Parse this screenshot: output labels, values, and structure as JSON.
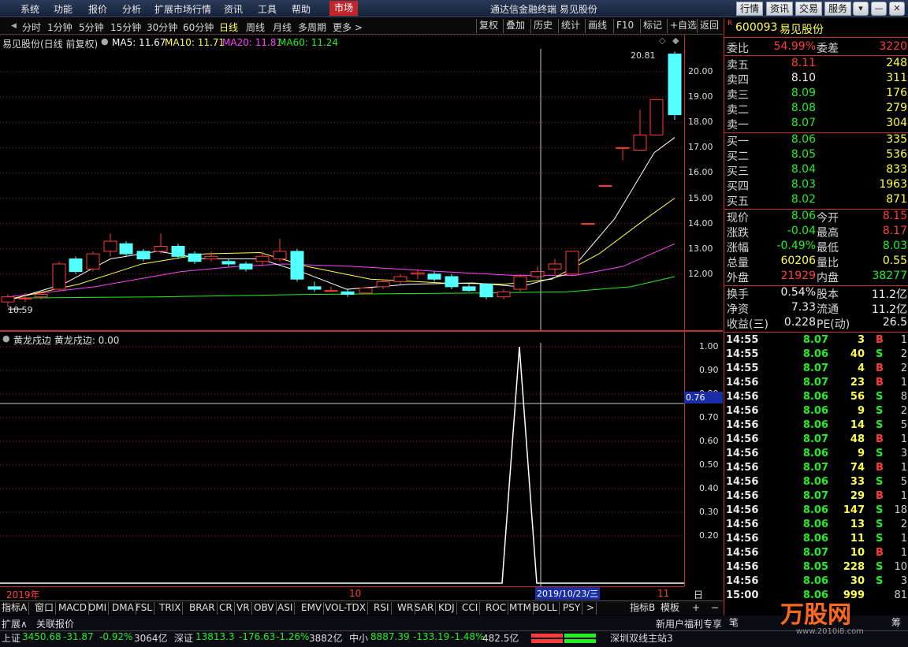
{
  "menu": {
    "items": [
      "系统",
      "功能",
      "报价",
      "分析",
      "扩展市场行情",
      "资讯",
      "工具",
      "帮助"
    ],
    "active": "市场",
    "app_title": "通达信金融终端 易见股份",
    "right_buttons": [
      "行情",
      "资讯",
      "交易",
      "服务"
    ]
  },
  "toolbar": {
    "periods": [
      "分时",
      "1分钟",
      "5分钟",
      "15分钟",
      "30分钟",
      "60分钟",
      "日线",
      "周线",
      "月线",
      "多周期",
      "更多 >"
    ],
    "active_period": "日线",
    "actions": [
      "复权",
      "叠加",
      "历史",
      "统计",
      "画线",
      "F10",
      "标记",
      "+自选",
      "返回"
    ]
  },
  "kline": {
    "header_name": "易见股份(日线 前复权)",
    "ma5": "MA5: 11.67",
    "ma10": "MA10: 11.71",
    "ma20": "MA20: 11.81",
    "ma60": "MA60: 11.24",
    "high_label": "20.81",
    "low_label": "10.59",
    "ylabels": [
      "20.00",
      "19.00",
      "18.00",
      "17.00",
      "16.00",
      "15.00",
      "14.00",
      "13.00",
      "12.00"
    ]
  },
  "indicator": {
    "header": "黄龙戍边  黄龙戍边: 0.00",
    "ylabels": [
      "1.00",
      "0.90",
      "0.80",
      "0.70",
      "0.60",
      "0.50",
      "0.40",
      "0.30",
      "0.20"
    ],
    "cursor_value": "0.76"
  },
  "dates": {
    "year": "2019年",
    "mid": "10",
    "cursor": "2019/10/23/三",
    "end": "11",
    "period": "日线"
  },
  "index_tabs": [
    "指标A",
    "窗口",
    "MACD",
    "DMI",
    "DMA",
    "FSL",
    "TRIX",
    "BRAR",
    "CR",
    "VR",
    "OBV",
    "ASI",
    "EMV",
    "VOL-TDX",
    "RSI",
    "WR",
    "SAR",
    "KDJ",
    "CCI",
    "ROC",
    "MTM",
    "BOLL",
    "PSY",
    ">"
  ],
  "index_right": [
    "指标B",
    "模板",
    "+",
    "−"
  ],
  "ext": {
    "left": "扩展∧",
    "mid": "关联报价",
    "right": "新用户福利专享"
  },
  "quote": {
    "code": "600093",
    "name": "易见股份",
    "weibi_label": "委比",
    "weibi": "54.99%",
    "weicha_label": "委差",
    "weicha": "3220",
    "sells": [
      {
        "label": "卖五",
        "price": "8.11",
        "vol": "248"
      },
      {
        "label": "卖四",
        "price": "8.10",
        "vol": "311"
      },
      {
        "label": "卖三",
        "price": "8.09",
        "vol": "176"
      },
      {
        "label": "卖二",
        "price": "8.08",
        "vol": "279"
      },
      {
        "label": "卖一",
        "price": "8.07",
        "vol": "304"
      }
    ],
    "buys": [
      {
        "label": "买一",
        "price": "8.06",
        "vol": "335"
      },
      {
        "label": "买二",
        "price": "8.05",
        "vol": "536"
      },
      {
        "label": "买三",
        "price": "8.04",
        "vol": "833"
      },
      {
        "label": "买四",
        "price": "8.03",
        "vol": "1963"
      },
      {
        "label": "买五",
        "price": "8.02",
        "vol": "871"
      }
    ],
    "stats": [
      {
        "l1": "现价",
        "v1": "8.06",
        "c1": "green",
        "l2": "今开",
        "v2": "8.15",
        "c2": "red"
      },
      {
        "l1": "涨跌",
        "v1": "-0.04",
        "c1": "green",
        "l2": "最高",
        "v2": "8.17",
        "c2": "red"
      },
      {
        "l1": "涨幅",
        "v1": "-0.49%",
        "c1": "green",
        "l2": "最低",
        "v2": "8.03",
        "c2": "green"
      },
      {
        "l1": "总量",
        "v1": "60206",
        "c1": "yellow",
        "l2": "量比",
        "v2": "0.55",
        "c2": "yellow"
      },
      {
        "l1": "外盘",
        "v1": "21929",
        "c1": "red",
        "l2": "内盘",
        "v2": "38277",
        "c2": "green"
      }
    ],
    "fund": [
      {
        "l1": "换手",
        "v1": "0.54%",
        "l2": "股本",
        "v2": "11.2亿"
      },
      {
        "l1": "净资",
        "v1": "7.33",
        "l2": "流通",
        "v2": "11.2亿"
      },
      {
        "l1": "收益(三)",
        "v1": "0.228",
        "l2": "PE(动)",
        "v2": "26.5"
      }
    ]
  },
  "ticks": [
    {
      "t": "14:55",
      "p": "8.07",
      "v": "3",
      "d": "B",
      "n": "1"
    },
    {
      "t": "14:55",
      "p": "8.06",
      "v": "40",
      "d": "S",
      "n": "2"
    },
    {
      "t": "14:55",
      "p": "8.07",
      "v": "4",
      "d": "B",
      "n": "2"
    },
    {
      "t": "14:56",
      "p": "8.07",
      "v": "23",
      "d": "B",
      "n": "1"
    },
    {
      "t": "14:56",
      "p": "8.06",
      "v": "56",
      "d": "S",
      "n": "8"
    },
    {
      "t": "14:56",
      "p": "8.06",
      "v": "9",
      "d": "S",
      "n": "2"
    },
    {
      "t": "14:56",
      "p": "8.06",
      "v": "14",
      "d": "S",
      "n": "5"
    },
    {
      "t": "14:56",
      "p": "8.07",
      "v": "48",
      "d": "B",
      "n": "1"
    },
    {
      "t": "14:56",
      "p": "8.06",
      "v": "9",
      "d": "S",
      "n": "3"
    },
    {
      "t": "14:56",
      "p": "8.07",
      "v": "74",
      "d": "B",
      "n": "1"
    },
    {
      "t": "14:56",
      "p": "8.06",
      "v": "33",
      "d": "S",
      "n": "5"
    },
    {
      "t": "14:56",
      "p": "8.07",
      "v": "29",
      "d": "B",
      "n": "1"
    },
    {
      "t": "14:56",
      "p": "8.06",
      "v": "147",
      "d": "S",
      "n": "18"
    },
    {
      "t": "14:56",
      "p": "8.06",
      "v": "13",
      "d": "S",
      "n": "2"
    },
    {
      "t": "14:56",
      "p": "8.06",
      "v": "11",
      "d": "S",
      "n": "1"
    },
    {
      "t": "14:56",
      "p": "8.07",
      "v": "10",
      "d": "B",
      "n": "1"
    },
    {
      "t": "14:56",
      "p": "8.05",
      "v": "228",
      "d": "S",
      "n": "10"
    },
    {
      "t": "14:56",
      "p": "8.06",
      "v": "30",
      "d": "S",
      "n": "3"
    },
    {
      "t": "15:00",
      "p": "8.06",
      "v": "999",
      "d": "",
      "n": "81"
    }
  ],
  "status": {
    "sh_label": "上证",
    "sh_val": "3450.68",
    "sh_chg": "-31.87",
    "sh_pct": "-0.92%",
    "sh_amt": "3064亿",
    "sz_label": "深证",
    "sz_val": "13813.3",
    "sz_chg": "-176.63",
    "sz_pct": "-1.26%",
    "sz_amt": "3882亿",
    "zx_label": "中小",
    "zx_val": "8887.39",
    "zx_chg": "-133.19",
    "zx_pct": "-1.48%",
    "zx_amt": "482.5亿",
    "server": "深圳双线主站3",
    "logo": "万股网",
    "logo_url": "www.2010i8.com"
  },
  "colors": {
    "up": "#ff3c3c",
    "down": "#54ffff",
    "ma5": "#ffffff",
    "ma10": "#ffff44",
    "ma20": "#ff44ff",
    "ma60": "#22ee22"
  }
}
